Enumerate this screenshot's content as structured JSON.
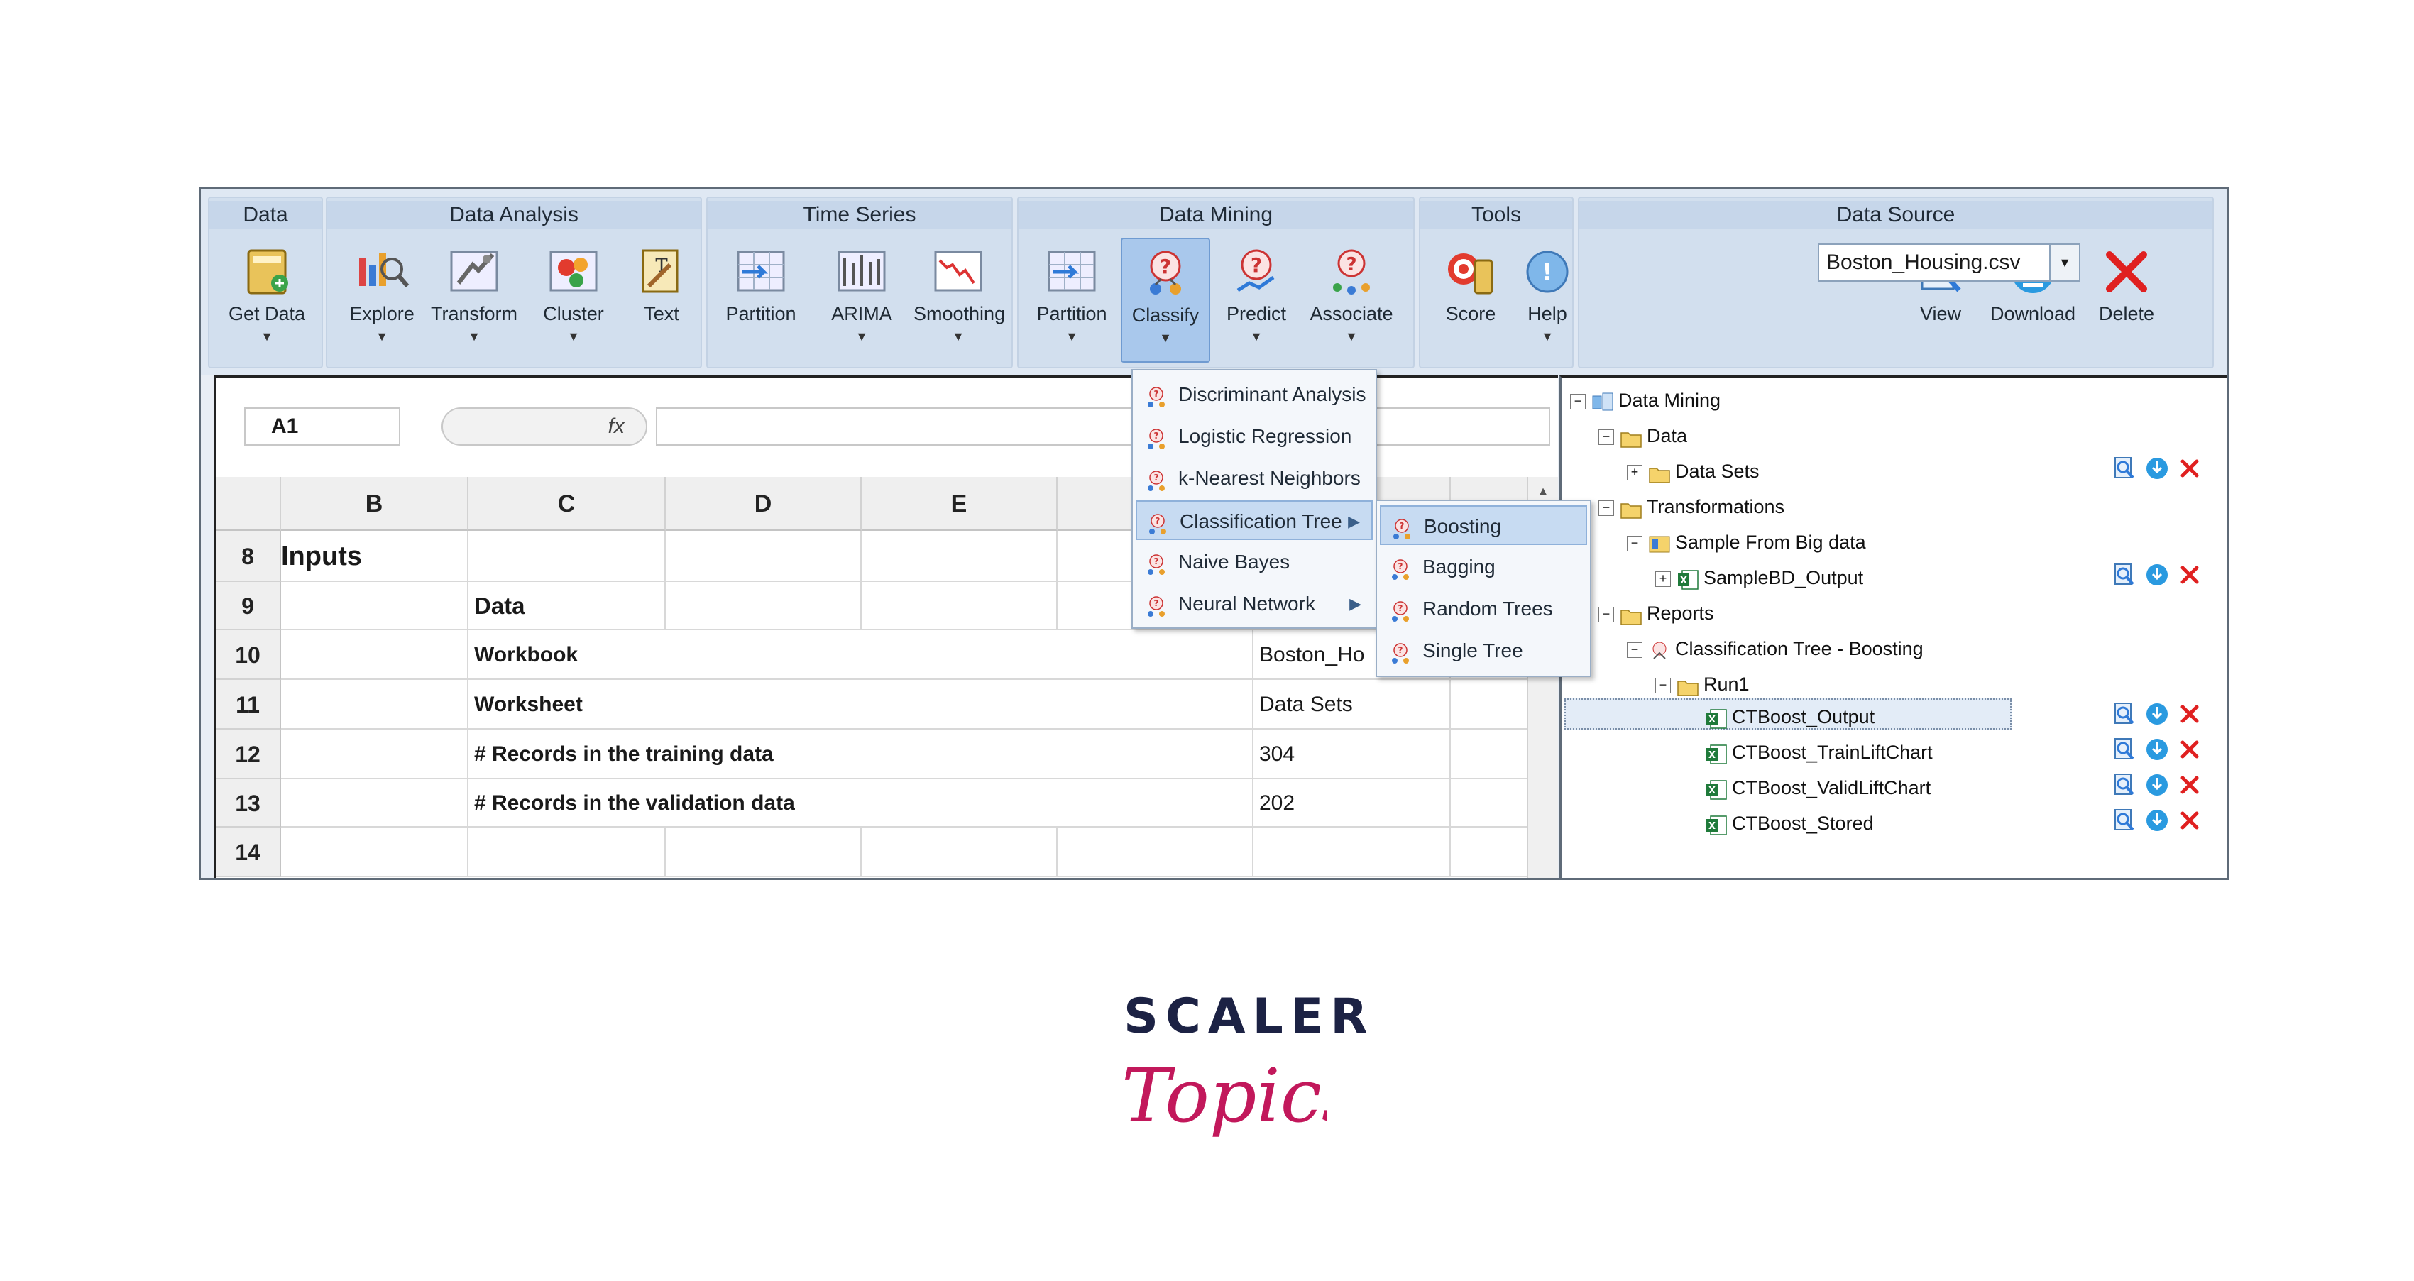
{
  "ribbon": {
    "groups": [
      {
        "title": "Data",
        "buttons": [
          {
            "label": "Get Data",
            "icon": "get-data-icon",
            "dropdown": true
          }
        ]
      },
      {
        "title": "Data Analysis",
        "buttons": [
          {
            "label": "Explore",
            "icon": "explore-icon",
            "dropdown": true
          },
          {
            "label": "Transform",
            "icon": "transform-icon",
            "dropdown": true
          },
          {
            "label": "Cluster",
            "icon": "cluster-icon",
            "dropdown": true
          },
          {
            "label": "Text",
            "icon": "text-mining-icon",
            "dropdown": false
          }
        ]
      },
      {
        "title": "Time Series",
        "buttons": [
          {
            "label": "Partition",
            "icon": "ts-partition-icon",
            "dropdown": false
          },
          {
            "label": "ARIMA",
            "icon": "arima-icon",
            "dropdown": true
          },
          {
            "label": "Smoothing",
            "icon": "smoothing-icon",
            "dropdown": true
          }
        ]
      },
      {
        "title": "Data Mining",
        "buttons": [
          {
            "label": "Partition",
            "icon": "dm-partition-icon",
            "dropdown": true
          },
          {
            "label": "Classify",
            "icon": "classify-icon",
            "dropdown": true,
            "active": true
          },
          {
            "label": "Predict",
            "icon": "predict-icon",
            "dropdown": true
          },
          {
            "label": "Associate",
            "icon": "associate-icon",
            "dropdown": true
          }
        ]
      },
      {
        "title": "Tools",
        "buttons": [
          {
            "label": "Score",
            "icon": "score-icon",
            "dropdown": false
          },
          {
            "label": "Help",
            "icon": "help-icon",
            "dropdown": true
          }
        ]
      },
      {
        "title": "Data Source",
        "buttons": [
          {
            "label": "View",
            "icon": "view-icon",
            "dropdown": false
          },
          {
            "label": "Download",
            "icon": "download-icon",
            "dropdown": false
          },
          {
            "label": "Delete",
            "icon": "delete-icon",
            "dropdown": false
          }
        ]
      }
    ],
    "data_source_value": "Boston_Housing.csv"
  },
  "formula_bar": {
    "cell_ref": "A1",
    "fx": "fx"
  },
  "sheet": {
    "columns": [
      "B",
      "C",
      "D",
      "E"
    ],
    "rows": [
      {
        "num": "8",
        "b": "Inputs",
        "c": "",
        "value": ""
      },
      {
        "num": "9",
        "b": "",
        "c": "Data",
        "value": ""
      },
      {
        "num": "10",
        "b": "",
        "c": "Workbook",
        "value": "Boston_Ho"
      },
      {
        "num": "11",
        "b": "",
        "c": "Worksheet",
        "value": "Data Sets"
      },
      {
        "num": "12",
        "b": "",
        "c": "# Records in the training data",
        "value": "304"
      },
      {
        "num": "13",
        "b": "",
        "c": "# Records in the validation data",
        "value": "202"
      },
      {
        "num": "14",
        "b": "",
        "c": "",
        "value": ""
      }
    ]
  },
  "classify_menu": [
    {
      "label": "Discriminant Analysis",
      "submenu": false
    },
    {
      "label": "Logistic Regression",
      "submenu": false
    },
    {
      "label": "k-Nearest Neighbors",
      "submenu": false
    },
    {
      "label": "Classification Tree",
      "submenu": true,
      "highlighted": true
    },
    {
      "label": "Naive Bayes",
      "submenu": false
    },
    {
      "label": "Neural Network",
      "submenu": true
    }
  ],
  "tree_submenu": [
    {
      "label": "Boosting",
      "highlighted": true
    },
    {
      "label": "Bagging"
    },
    {
      "label": "Random Trees"
    },
    {
      "label": "Single Tree"
    }
  ],
  "explorer": {
    "nodes": [
      {
        "label": "Data Mining",
        "level": 0,
        "icon": "data-mining-icon",
        "expander": "minus"
      },
      {
        "label": "Data",
        "level": 1,
        "icon": "folder-icon",
        "expander": "minus"
      },
      {
        "label": "Data Sets",
        "level": 2,
        "icon": "folder-icon",
        "expander": "plus",
        "actions": true
      },
      {
        "label": "Transformations",
        "level": 1,
        "icon": "folder-icon",
        "expander": "minus"
      },
      {
        "label": "Sample From Big data",
        "level": 2,
        "icon": "sample-icon",
        "expander": "minus"
      },
      {
        "label": "SampleBD_Output",
        "level": 3,
        "icon": "excel-icon",
        "expander": "plus",
        "actions": true
      },
      {
        "label": "Reports",
        "level": 1,
        "icon": "folder-icon",
        "expander": "minus"
      },
      {
        "label": "Classification Tree - Boosting",
        "level": 2,
        "icon": "model-icon",
        "expander": "minus"
      },
      {
        "label": "Run1",
        "level": 3,
        "icon": "folder-icon",
        "expander": "minus"
      },
      {
        "label": "CTBoost_Output",
        "level": 4,
        "icon": "excel-icon",
        "expander": "",
        "actions": true,
        "selected": true
      },
      {
        "label": "CTBoost_TrainLiftChart",
        "level": 4,
        "icon": "excel-icon",
        "expander": "",
        "actions": true
      },
      {
        "label": "CTBoost_ValidLiftChart",
        "level": 4,
        "icon": "excel-icon",
        "expander": "",
        "actions": true
      },
      {
        "label": "CTBoost_Stored",
        "level": 4,
        "icon": "excel-icon",
        "expander": "",
        "actions": true
      }
    ]
  },
  "logo": {
    "line1": "SCALER",
    "line2": "Topics"
  },
  "colors": {
    "accent": "#6f9bd1",
    "logo_dark": "#1c2244",
    "logo_pink": "#c2185b",
    "delete_red": "#e02020",
    "download_blue": "#2a9ae0"
  }
}
